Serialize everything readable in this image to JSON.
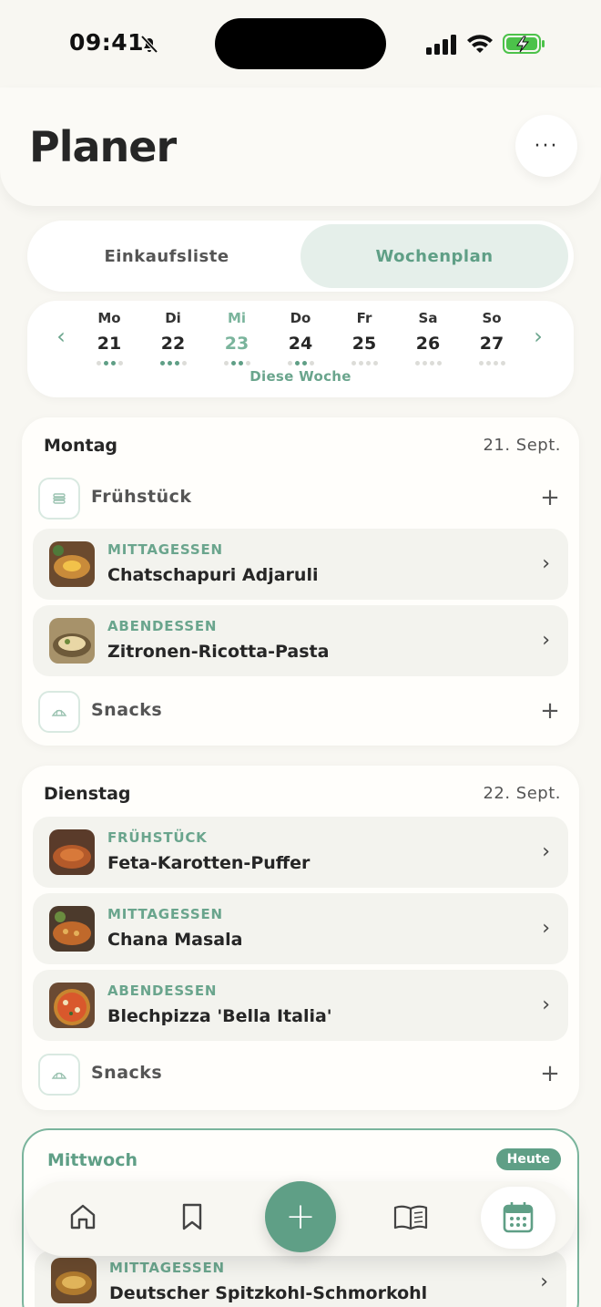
{
  "status_bar": {
    "time": "09:41"
  },
  "header": {
    "title": "Planer"
  },
  "segmented": {
    "tabs": [
      "Einkaufsliste",
      "Wochenplan"
    ],
    "selected": "Wochenplan"
  },
  "week": {
    "label": "Diese Woche",
    "days": [
      {
        "name": "Mo",
        "date": "21",
        "dots_filled": 2,
        "active": false
      },
      {
        "name": "Di",
        "date": "22",
        "dots_filled": 3,
        "active": false
      },
      {
        "name": "Mi",
        "date": "23",
        "dots_filled": 2,
        "active": true
      },
      {
        "name": "Do",
        "date": "24",
        "dots_filled": 2,
        "active": false
      },
      {
        "name": "Fr",
        "date": "25",
        "dots_filled": 0,
        "active": false
      },
      {
        "name": "Sa",
        "date": "26",
        "dots_filled": 0,
        "active": false
      },
      {
        "name": "So",
        "date": "27",
        "dots_filled": 0,
        "active": false
      }
    ]
  },
  "monday": {
    "day": "Montag",
    "date": "21. Sept.",
    "breakfast_empty": "Frühstück",
    "meals": [
      {
        "type": "MITTAGESSEN",
        "name": "Chatschapuri Adjaruli"
      },
      {
        "type": "ABENDESSEN",
        "name": "Zitronen-Ricotta-Pasta"
      }
    ],
    "snacks_empty": "Snacks"
  },
  "tuesday": {
    "day": "Dienstag",
    "date": "22. Sept.",
    "meals": [
      {
        "type": "FRÜHSTÜCK",
        "name": "Feta-Karotten-Puffer"
      },
      {
        "type": "MITTAGESSEN",
        "name": "Chana Masala"
      },
      {
        "type": "ABENDESSEN",
        "name": "Blechpizza 'Bella Italia'"
      }
    ],
    "snacks_empty": "Snacks"
  },
  "wednesday": {
    "day": "Mittwoch",
    "badge": "Heute",
    "meals": [
      {
        "type": "MITTAGESSEN",
        "name": "Deutscher Spitzkohl-Schmorkohl"
      }
    ]
  },
  "nav": {
    "items": [
      "home-icon",
      "bookmark-icon",
      "add-icon",
      "book-open-icon",
      "calendar-icon"
    ],
    "active": "calendar-icon",
    "accent": "#5f9f86"
  }
}
